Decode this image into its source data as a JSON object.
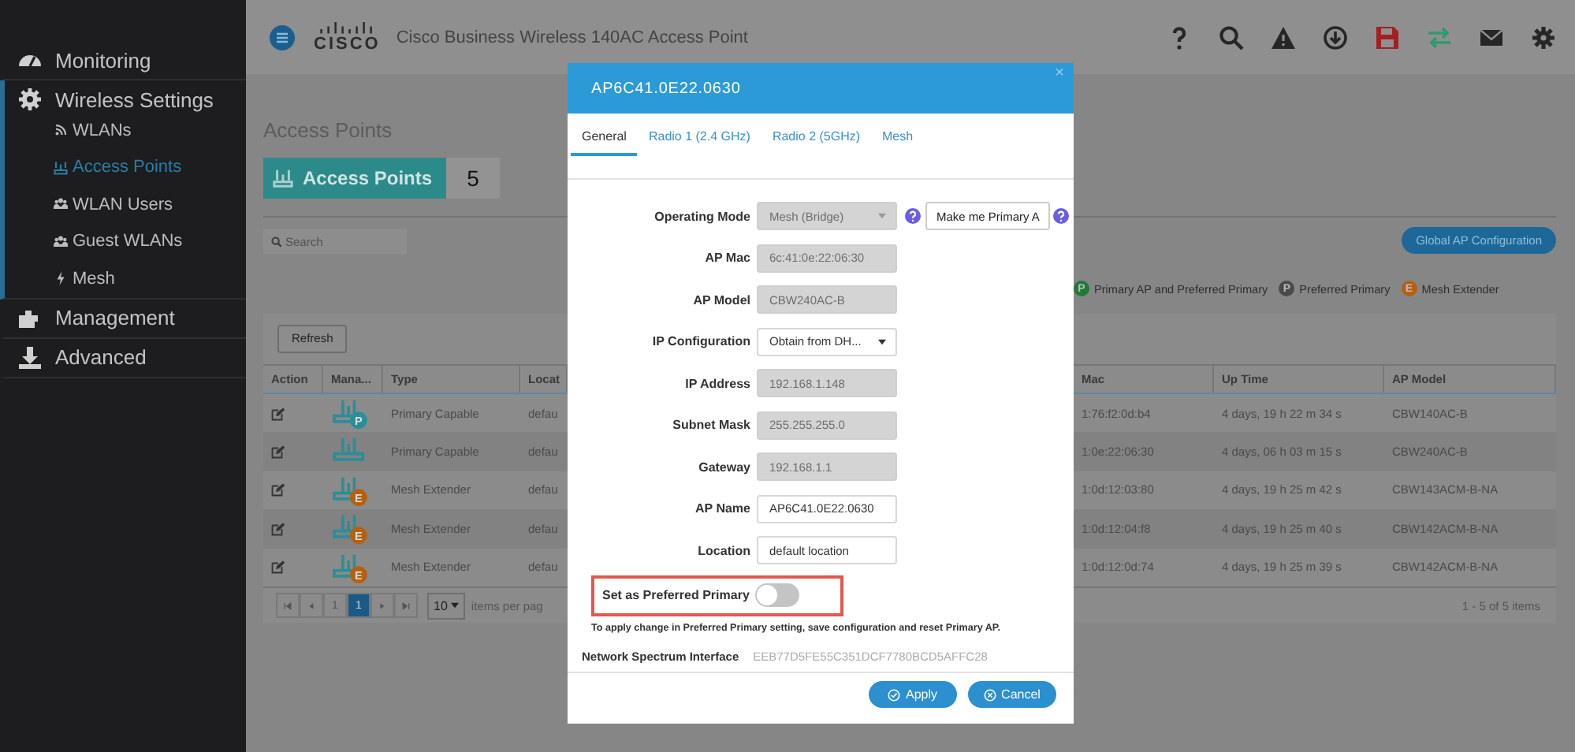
{
  "sidebar": {
    "sections": [
      {
        "label": "Monitoring",
        "active": false
      },
      {
        "label": "Wireless Settings",
        "active": true,
        "children": [
          {
            "label": "WLANs",
            "selected": false
          },
          {
            "label": "Access Points",
            "selected": true
          },
          {
            "label": "WLAN Users",
            "selected": false
          },
          {
            "label": "Guest WLANs",
            "selected": false
          },
          {
            "label": "Mesh",
            "selected": false
          }
        ]
      },
      {
        "label": "Management",
        "active": false
      },
      {
        "label": "Advanced",
        "active": false
      }
    ]
  },
  "topbar": {
    "logo": "CISCO",
    "title": "Cisco Business Wireless 140AC Access Point"
  },
  "page": {
    "title": "Access Points",
    "badge_label": "Access Points",
    "badge_count": "5",
    "search": {
      "placeholder": "Search"
    },
    "refresh_button": "Refresh",
    "global_button": "Global AP Configuration",
    "legend": [
      {
        "letter": "P",
        "label": "Primary AP and Preferred Primary",
        "color": "#1f7a3a"
      },
      {
        "letter": "P",
        "label": "Preferred Primary",
        "color": "#4a4a4a"
      },
      {
        "letter": "E",
        "label": "Mesh Extender",
        "color": "#b5600f"
      }
    ]
  },
  "table": {
    "left_columns": [
      "Action",
      "Mana...",
      "Type",
      "Locat"
    ],
    "right_columns": [
      "Mac",
      "Up Time",
      "AP Model"
    ],
    "rows": [
      {
        "badge": "P",
        "color": "#2a8f96",
        "type": "Primary Capable",
        "location": "defau",
        "mac": "1:76:f2:0d:b4",
        "uptime": "4 days, 19 h 22 m 34 s",
        "model": "CBW140AC-B"
      },
      {
        "type": "Primary Capable",
        "location": "defau",
        "mac": "1:0e:22:06:30",
        "uptime": "4 days, 06 h 03 m 15 s",
        "model": "CBW240AC-B"
      },
      {
        "badge": "E",
        "color": "#b5600f",
        "type": "Mesh Extender",
        "location": "defau",
        "mac": "1:0d:12:03:80",
        "uptime": "4 days, 19 h 25 m 42 s",
        "model": "CBW143ACM-B-NA"
      },
      {
        "badge": "E",
        "color": "#b5600f",
        "type": "Mesh Extender",
        "location": "defau",
        "mac": "1:0d:12:04:f8",
        "uptime": "4 days, 19 h 25 m 40 s",
        "model": "CBW142ACM-B-NA"
      },
      {
        "badge": "E",
        "color": "#b5600f",
        "type": "Mesh Extender",
        "location": "defau",
        "mac": "1:0d:12:0d:74",
        "uptime": "4 days, 19 h 25 m 39 s",
        "model": "CBW142ACM-B-NA"
      }
    ],
    "pager": {
      "pages": [
        {
          "label": "1",
          "selected": false
        },
        {
          "label": "1",
          "selected": true
        }
      ],
      "page_size": "10",
      "per_page_label": "items per pag",
      "summary": "1 - 5 of 5 items"
    }
  },
  "modal": {
    "title": "AP6C41.0E22.0630",
    "close": "×",
    "tabs": [
      {
        "label": "General",
        "selected": true
      },
      {
        "label": "Radio 1 (2.4 GHz)",
        "selected": false
      },
      {
        "label": "Radio 2 (5GHz)",
        "selected": false
      },
      {
        "label": "Mesh",
        "selected": false
      }
    ],
    "fields": [
      {
        "kind": "select",
        "label": "Operating Mode",
        "value": "Mesh (Bridge)",
        "disabled": true,
        "help": true,
        "extra_button": "Make me Primary A"
      },
      {
        "kind": "input",
        "label": "AP Mac",
        "value": "6c:41:0e:22:06:30",
        "disabled": true
      },
      {
        "kind": "input",
        "label": "AP Model",
        "value": "CBW240AC-B",
        "disabled": true
      },
      {
        "kind": "select",
        "label": "IP Configuration",
        "value": "Obtain from DH...",
        "disabled": false
      },
      {
        "kind": "input",
        "label": "IP Address",
        "value": "192.168.1.148",
        "disabled": true
      },
      {
        "kind": "input",
        "label": "Subnet Mask",
        "value": "255.255.255.0",
        "disabled": true
      },
      {
        "kind": "input",
        "label": "Gateway",
        "value": "192.168.1.1",
        "disabled": true
      },
      {
        "kind": "input",
        "label": "AP Name",
        "value": "AP6C41.0E22.0630",
        "disabled": false
      },
      {
        "kind": "input",
        "label": "Location",
        "value": "default location",
        "disabled": false
      },
      {
        "kind": "toggle",
        "label": "Set as Preferred Primary",
        "on": false,
        "highlighted": true
      }
    ],
    "note": "To apply change in Preferred Primary setting, save configuration and reset Primary AP.",
    "spectrum_label": "Network Spectrum Interface",
    "spectrum_value": "EEB77D5FE55C351DCF7780BCD5AFFC28",
    "buttons": [
      {
        "kind": "apply",
        "label": "Apply"
      },
      {
        "kind": "cancel",
        "label": "Cancel"
      }
    ]
  }
}
